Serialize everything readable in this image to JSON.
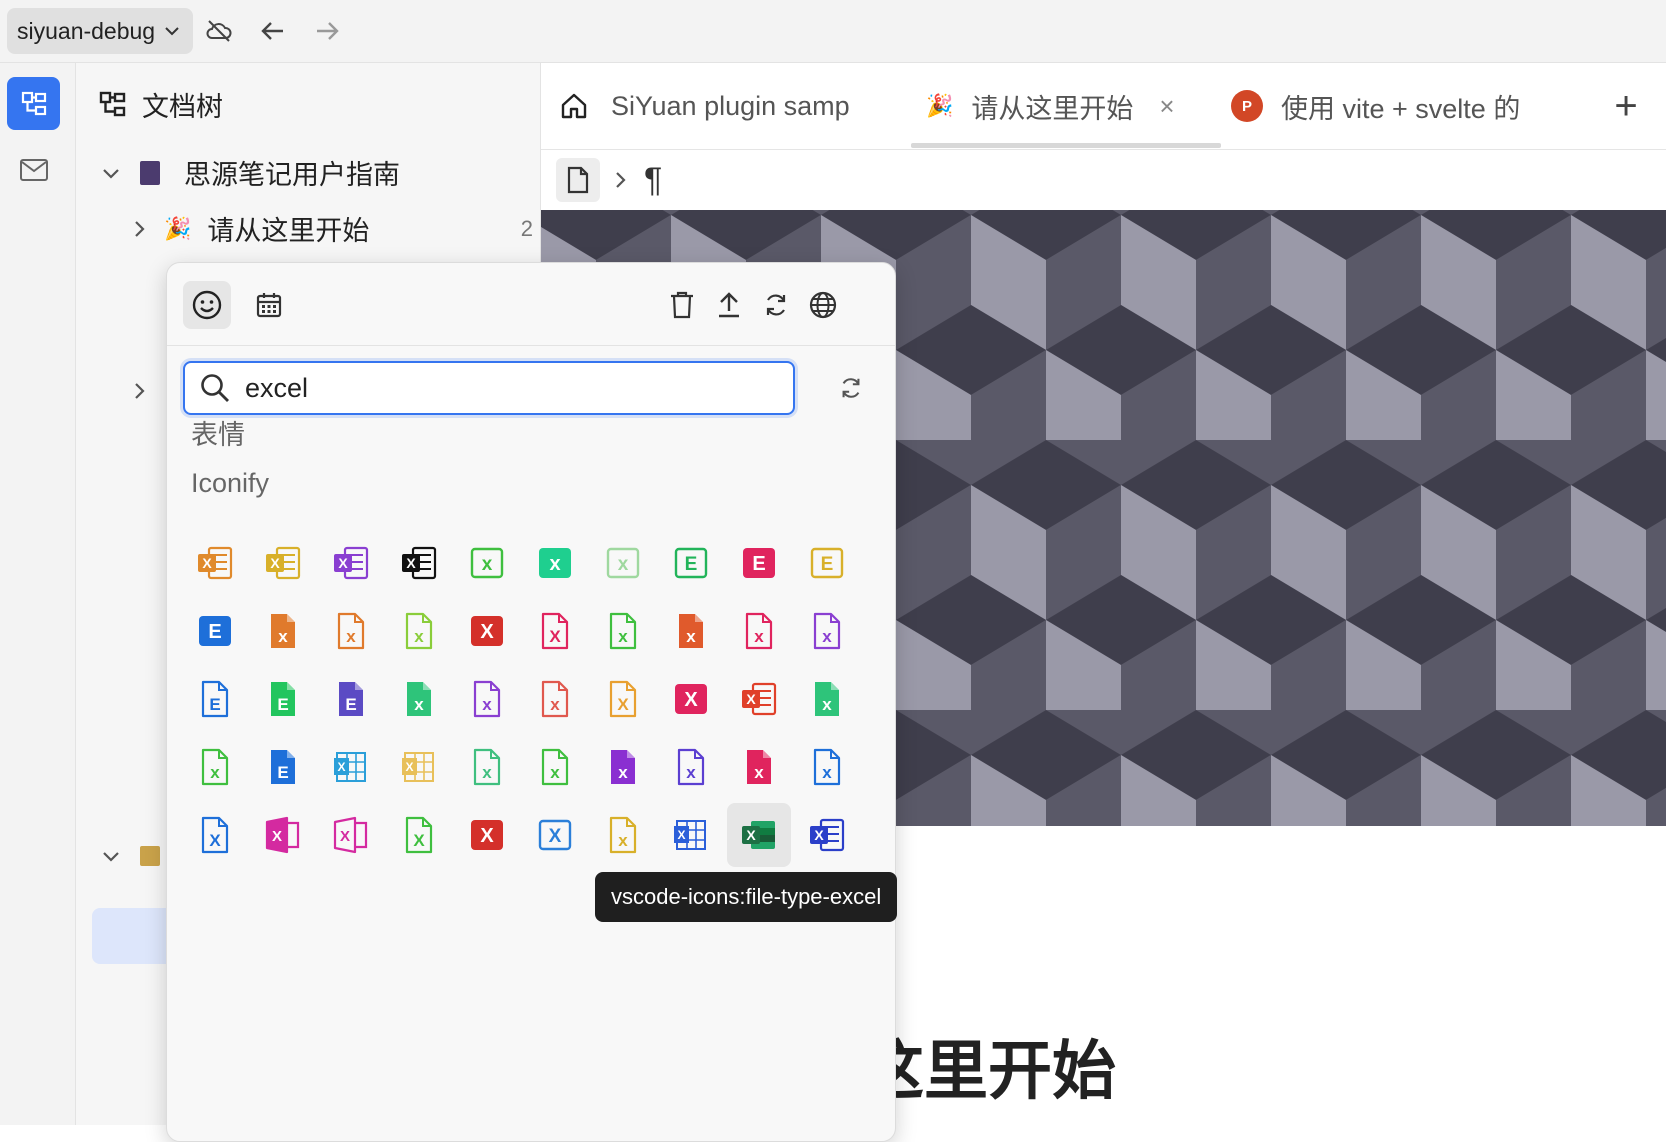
{
  "topbar": {
    "workspace": "siyuan-debug"
  },
  "filetree": {
    "title": "文档树",
    "notebook": "思源笔记用户指南",
    "child": "请从这里开始",
    "child_count": "2"
  },
  "tabs": [
    {
      "label": "SiYuan plugin samp"
    },
    {
      "label": "请从这里开始",
      "close": "×"
    },
    {
      "label": "使用 vite + svelte 的"
    }
  ],
  "tab_add": "+",
  "breadcrumb": {
    "pilcrow": "¶"
  },
  "document": {
    "title_visible": "这里开始"
  },
  "icon_picker": {
    "search_value": "excel",
    "section_emoji": "表情",
    "section_iconify": "Iconify",
    "tooltip": "vscode-icons:file-type-excel",
    "icons": [
      {
        "name": "excel-icon-1",
        "color": "#e08a2c",
        "letter": "X",
        "style": "doc"
      },
      {
        "name": "excel-icon-2",
        "color": "#d8b02a",
        "letter": "X",
        "style": "doc"
      },
      {
        "name": "excel-icon-3",
        "color": "#8a3fd1",
        "letter": "X",
        "style": "doc"
      },
      {
        "name": "excel-icon-4",
        "color": "#111111",
        "letter": "X",
        "style": "doc"
      },
      {
        "name": "excel-icon-5",
        "color": "#3fbf3f",
        "letter": "x",
        "style": "outline"
      },
      {
        "name": "excel-icon-6",
        "color": "#1fcf8f",
        "letter": "x",
        "style": "fill"
      },
      {
        "name": "excel-icon-7",
        "color": "#9fd89f",
        "letter": "x",
        "style": "outline"
      },
      {
        "name": "excel-icon-8",
        "color": "#22b45a",
        "letter": "E",
        "style": "outline"
      },
      {
        "name": "excel-icon-9",
        "color": "#e0245e",
        "letter": "E",
        "style": "fill"
      },
      {
        "name": "excel-icon-10",
        "color": "#d8b02a",
        "letter": "E",
        "style": "outline"
      },
      {
        "name": "excel-icon-11",
        "color": "#1e6fd9",
        "letter": "E",
        "style": "fill"
      },
      {
        "name": "excel-icon-12",
        "color": "#e07a2c",
        "letter": "x",
        "style": "file-fill"
      },
      {
        "name": "excel-icon-13",
        "color": "#e07a2c",
        "letter": "x",
        "style": "file"
      },
      {
        "name": "excel-icon-14",
        "color": "#8acd3a",
        "letter": "x",
        "style": "file"
      },
      {
        "name": "excel-icon-15",
        "color": "#d4302a",
        "letter": "X",
        "style": "fill"
      },
      {
        "name": "excel-icon-16",
        "color": "#e0245e",
        "letter": "X",
        "style": "file"
      },
      {
        "name": "excel-icon-17",
        "color": "#3fbf3f",
        "letter": "x",
        "style": "file"
      },
      {
        "name": "excel-icon-18",
        "color": "#e05a2c",
        "letter": "x",
        "style": "file-fill"
      },
      {
        "name": "excel-icon-19",
        "color": "#e0245e",
        "letter": "x",
        "style": "file"
      },
      {
        "name": "excel-icon-20",
        "color": "#8a3fd1",
        "letter": "x",
        "style": "file"
      },
      {
        "name": "excel-icon-21",
        "color": "#1e6fd9",
        "letter": "E",
        "style": "file"
      },
      {
        "name": "excel-icon-22",
        "color": "#22c55e",
        "letter": "E",
        "style": "file-fill"
      },
      {
        "name": "excel-icon-23",
        "color": "#5b4bc4",
        "letter": "E",
        "style": "file-fill"
      },
      {
        "name": "excel-icon-24",
        "color": "#2ec47a",
        "letter": "x",
        "style": "file-fill"
      },
      {
        "name": "excel-icon-25",
        "color": "#8a3fd1",
        "letter": "x",
        "style": "file"
      },
      {
        "name": "excel-icon-26",
        "color": "#e0584e",
        "letter": "x",
        "style": "file"
      },
      {
        "name": "excel-icon-27",
        "color": "#e8a030",
        "letter": "X",
        "style": "file"
      },
      {
        "name": "excel-icon-28",
        "color": "#e0245e",
        "letter": "X",
        "style": "fill"
      },
      {
        "name": "excel-icon-29",
        "color": "#e0402a",
        "letter": "X",
        "style": "doc"
      },
      {
        "name": "excel-icon-30",
        "color": "#2ec47a",
        "letter": "x",
        "style": "file-fill"
      },
      {
        "name": "excel-icon-31",
        "color": "#3fbf3f",
        "letter": "x",
        "style": "file"
      },
      {
        "name": "excel-icon-32",
        "color": "#1e6fd9",
        "letter": "E",
        "style": "file-fill"
      },
      {
        "name": "excel-icon-33",
        "color": "#2b9fd9",
        "letter": "X",
        "style": "grid"
      },
      {
        "name": "excel-icon-34",
        "color": "#e8c05a",
        "letter": "X",
        "style": "grid"
      },
      {
        "name": "excel-icon-35",
        "color": "#3fbf7f",
        "letter": "x",
        "style": "file"
      },
      {
        "name": "excel-icon-36",
        "color": "#3fbf3f",
        "letter": "x",
        "style": "file"
      },
      {
        "name": "excel-icon-37",
        "color": "#8a2fd1",
        "letter": "x",
        "style": "file-fill"
      },
      {
        "name": "excel-icon-38",
        "color": "#5b3fd1",
        "letter": "x",
        "style": "file"
      },
      {
        "name": "excel-icon-39",
        "color": "#e0245e",
        "letter": "x",
        "style": "file-fill"
      },
      {
        "name": "excel-icon-40",
        "color": "#1e6fd9",
        "letter": "x",
        "style": "file"
      },
      {
        "name": "excel-icon-41",
        "color": "#1e6fd9",
        "letter": "X",
        "style": "file"
      },
      {
        "name": "excel-icon-42",
        "color": "#d42aa0",
        "letter": "X",
        "style": "office-fill"
      },
      {
        "name": "excel-icon-43",
        "color": "#d42aa0",
        "letter": "X",
        "style": "office"
      },
      {
        "name": "excel-icon-44",
        "color": "#3fbf3f",
        "letter": "X",
        "style": "file"
      },
      {
        "name": "excel-icon-45",
        "color": "#d4302a",
        "letter": "X",
        "style": "fill"
      },
      {
        "name": "excel-icon-46",
        "color": "#2b7fd9",
        "letter": "X",
        "style": "outline"
      },
      {
        "name": "excel-icon-47",
        "color": "#d8b02a",
        "letter": "x",
        "style": "file"
      },
      {
        "name": "excel-icon-48",
        "color": "#2b5fd9",
        "letter": "X",
        "style": "grid"
      },
      {
        "name": "vscode-file-type-excel-icon",
        "color": "#1d7044",
        "letter": "X",
        "style": "vscode"
      },
      {
        "name": "excel-icon-50",
        "color": "#2b3fc9",
        "letter": "X",
        "style": "doc"
      }
    ]
  },
  "colors": {
    "accent": "#3575f0",
    "banner_dark": "#3f3e4c",
    "banner_mid": "#5a5968",
    "banner_light": "#9a99a8"
  }
}
